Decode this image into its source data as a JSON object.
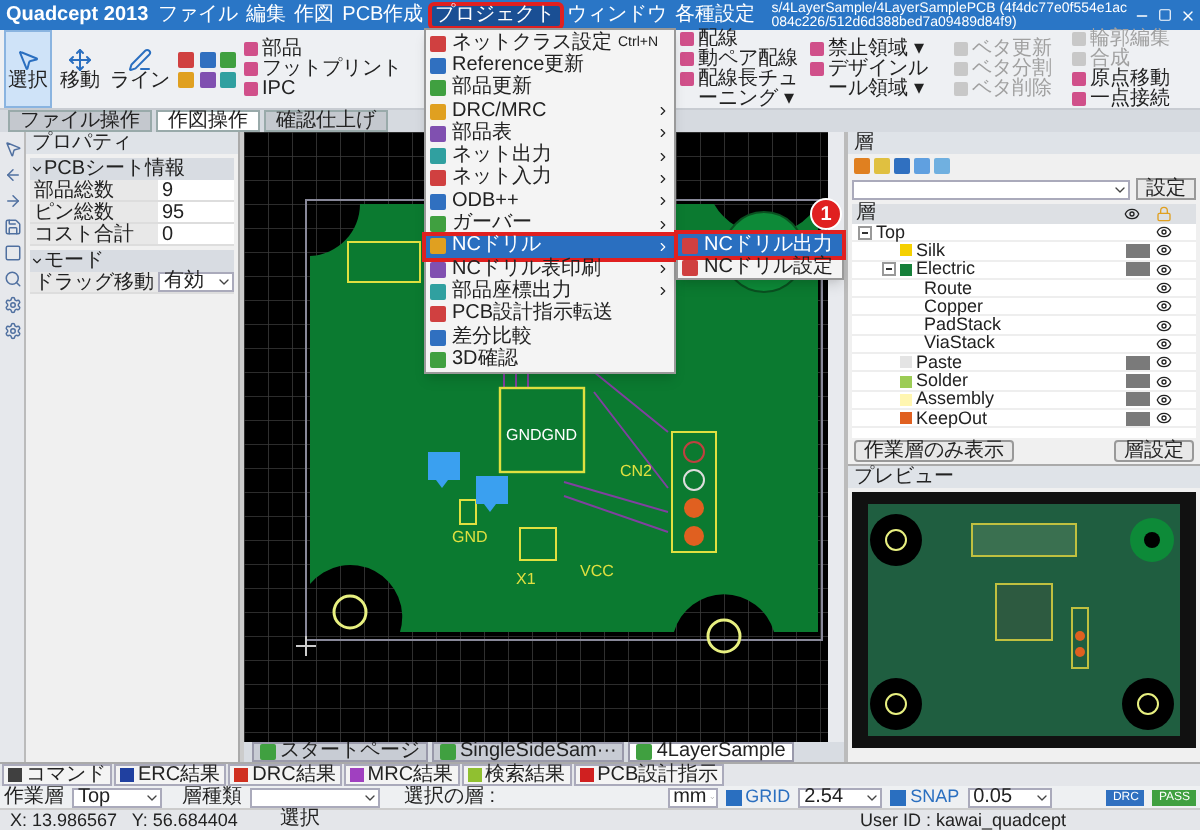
{
  "title_bar": {
    "logo": "Quadcept 2013",
    "path": "s/4LayerSample/4LayerSamplePCB (4f4dc77e0f554e1ac084c226/512d6d388bed7a09489d84f9)",
    "menu": [
      {
        "label": "ファイル",
        "selected": false
      },
      {
        "label": "編集",
        "selected": false
      },
      {
        "label": "作図",
        "selected": false
      },
      {
        "label": "PCB作成",
        "selected": false
      },
      {
        "label": "プロジェクト",
        "selected": true
      },
      {
        "label": "ウィンドウ",
        "selected": false
      },
      {
        "label": "各種設定",
        "selected": false
      }
    ]
  },
  "ribbon": {
    "big_buttons": [
      {
        "label": "選択",
        "selected": true
      },
      {
        "label": "移動",
        "selected": false
      },
      {
        "label": "ライン",
        "selected": false
      }
    ],
    "columns": [
      [
        {
          "label": "部品",
          "disabled": false
        },
        {
          "label": "フットプリント",
          "disabled": false
        },
        {
          "label": "IPC",
          "disabled": false
        }
      ],
      [
        {
          "label": "配線",
          "disabled": false
        },
        {
          "label": "動ペア配線",
          "disabled": false
        },
        {
          "label": "配線長チューニング ▾",
          "disabled": false
        }
      ],
      [
        {
          "label": "禁止領域 ▾",
          "disabled": false
        },
        {
          "label": "デザインルール領域 ▾",
          "disabled": false
        }
      ],
      [
        {
          "label": "ベタ更新",
          "disabled": true
        },
        {
          "label": "ベタ分割",
          "disabled": true
        },
        {
          "label": "ベタ削除",
          "disabled": true
        }
      ],
      [
        {
          "label": "輪郭編集",
          "disabled": true
        },
        {
          "label": "合成",
          "disabled": true
        }
      ],
      [
        {
          "label": "原点移動",
          "disabled": false
        },
        {
          "label": "一点接続",
          "disabled": false
        }
      ]
    ],
    "tabs": [
      {
        "label": "ファイル操作",
        "selected": false
      },
      {
        "label": "作図操作",
        "selected": true
      },
      {
        "label": "確認仕上げ",
        "selected": false
      }
    ]
  },
  "project_menu": {
    "items": [
      {
        "label": "ネットクラス設定",
        "shortcut": "Ctrl+N",
        "submenu": false,
        "selected": false
      },
      {
        "label": "Reference更新",
        "submenu": false,
        "selected": false
      },
      {
        "label": "部品更新",
        "submenu": false,
        "selected": false
      },
      {
        "label": "DRC/MRC",
        "submenu": true,
        "selected": false
      },
      {
        "label": "部品表",
        "submenu": true,
        "selected": false
      },
      {
        "label": "ネット出力",
        "submenu": true,
        "selected": false
      },
      {
        "label": "ネット入力",
        "submenu": true,
        "selected": false
      },
      {
        "label": "ODB++",
        "submenu": true,
        "selected": false
      },
      {
        "label": "ガーバー",
        "submenu": true,
        "selected": false
      },
      {
        "label": "NCドリル",
        "submenu": true,
        "selected": true
      },
      {
        "label": "NCドリル表印刷",
        "submenu": true,
        "selected": false
      },
      {
        "label": "部品座標出力",
        "submenu": true,
        "selected": false
      },
      {
        "label": "PCB設計指示転送",
        "submenu": false,
        "selected": false
      },
      {
        "label": "差分比較",
        "submenu": false,
        "selected": false
      },
      {
        "label": "3D確認",
        "submenu": false,
        "selected": false
      }
    ]
  },
  "submenu": {
    "items": [
      {
        "label": "NCドリル出力",
        "selected": true
      },
      {
        "label": "NCドリル設定",
        "selected": false
      }
    ]
  },
  "step_badge": "1",
  "properties": {
    "title": "プロパティ",
    "sections": [
      {
        "title": "PCBシート情報",
        "expanded": true,
        "rows": [
          {
            "name": "部品総数",
            "value": "9",
            "kind": "text"
          },
          {
            "name": "ピン総数",
            "value": "95",
            "kind": "text"
          },
          {
            "name": "コスト合計",
            "value": "0",
            "kind": "text"
          }
        ]
      },
      {
        "title": "モード",
        "expanded": true,
        "rows": [
          {
            "name": "ドラッグ移動",
            "value": "有効",
            "kind": "select"
          }
        ]
      }
    ]
  },
  "canvas": {
    "labels": [
      "GNDGND",
      "GND",
      "VCC",
      "X1",
      "CN2"
    ],
    "tabs": [
      {
        "label": "スタートページ",
        "selected": false
      },
      {
        "label": "SingleSideSam···",
        "selected": false
      },
      {
        "label": "4LayerSample",
        "selected": true
      }
    ]
  },
  "layers": {
    "title": "層",
    "settings_button": "設定",
    "column": "層",
    "rows": [
      {
        "name": "Top",
        "expanded": true,
        "children": [
          {
            "name": "Silk",
            "color": "#f5d000"
          },
          {
            "name": "Electric",
            "color": "#16803a",
            "expanded": true,
            "children": [
              {
                "name": "Route"
              },
              {
                "name": "Copper"
              },
              {
                "name": "PadStack"
              },
              {
                "name": "ViaStack"
              }
            ]
          },
          {
            "name": "Paste",
            "color": "#e4e4e4"
          },
          {
            "name": "Solder",
            "color": "#9ccc55"
          },
          {
            "name": "Assembly",
            "color": "#fff6b0"
          },
          {
            "name": "KeepOut",
            "color": "#e06020"
          }
        ]
      }
    ],
    "buttons": [
      "作業層のみ表示",
      "層設定"
    ]
  },
  "preview": {
    "title": "プレビュー"
  },
  "result_tabs": [
    {
      "label": "コマンド",
      "color": "#404040"
    },
    {
      "label": "ERC結果",
      "color": "#2040a0"
    },
    {
      "label": "DRC結果",
      "color": "#d03020"
    },
    {
      "label": "MRC結果",
      "color": "#a040c0"
    },
    {
      "label": "検索結果",
      "color": "#90c030"
    },
    {
      "label": "PCB設計指示",
      "color": "#d02020"
    }
  ],
  "toolbar": {
    "work_layer": {
      "label": "作業層",
      "value": "Top"
    },
    "layer_type": {
      "label": "層種類"
    },
    "selected_layer": "選択の層 :",
    "unit": "mm",
    "grid": {
      "label": "GRID",
      "checked": true,
      "value": "2.54"
    },
    "snap": {
      "label": "SNAP",
      "checked": true,
      "value": "0.05"
    },
    "badges": [
      "DRC",
      "PASS"
    ]
  },
  "status_bar": {
    "coords": "X: 13.986567   Y: 56.684404",
    "mode": "選択",
    "user": "User ID : kawai_quadcept"
  }
}
